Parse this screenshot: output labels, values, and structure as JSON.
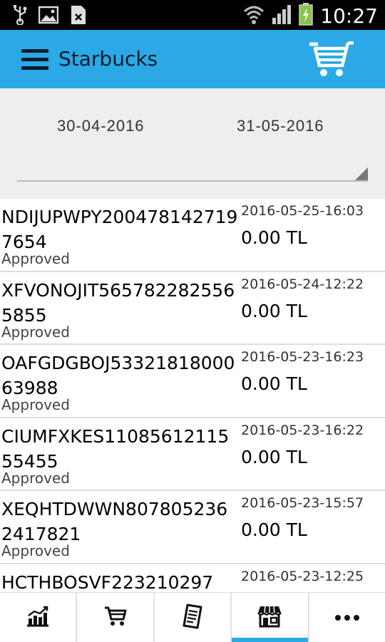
{
  "status_bar": {
    "time": "10:27",
    "icons": [
      "usb-icon",
      "image-icon",
      "sim-error-icon",
      "wifi-icon",
      "signal-icon",
      "battery-charging-icon"
    ]
  },
  "app_bar": {
    "title": "Starbucks",
    "menu_icon": "hamburger-menu-icon",
    "cart_icon": "shopping-cart-icon",
    "color": "#2aa9e6"
  },
  "filter": {
    "date_from": "30-04-2016",
    "date_to": "31-05-2016",
    "dropdown_value": ""
  },
  "transactions": [
    {
      "code": "NDIJUPWPY2004781427197654",
      "status": "Approved",
      "timestamp": "2016-05-25-16:03",
      "amount": "0.00 TL"
    },
    {
      "code": "XFVONOJIT5657822825565855",
      "status": "Approved",
      "timestamp": "2016-05-24-12:22",
      "amount": "0.00 TL"
    },
    {
      "code": "OAFGDGBOJ5332181800063988",
      "status": "Approved",
      "timestamp": "2016-05-23-16:23",
      "amount": "0.00 TL"
    },
    {
      "code": "CIUMFXKES1108561211555455",
      "status": "Approved",
      "timestamp": "2016-05-23-16:22",
      "amount": "0.00 TL"
    },
    {
      "code": "XEQHTDWWN8078052362417821",
      "status": "Approved",
      "timestamp": "2016-05-23-15:57",
      "amount": "0.00 TL"
    },
    {
      "code": "HCTHBOSVF223210297",
      "status": "",
      "timestamp": "2016-05-23-12:25",
      "amount": ""
    }
  ],
  "bottom_nav": [
    {
      "icon": "chart-icon",
      "active": false
    },
    {
      "icon": "cart-icon",
      "active": false
    },
    {
      "icon": "receipt-icon",
      "active": false
    },
    {
      "icon": "store-icon",
      "active": true
    },
    {
      "icon": "more-icon",
      "active": false
    }
  ]
}
